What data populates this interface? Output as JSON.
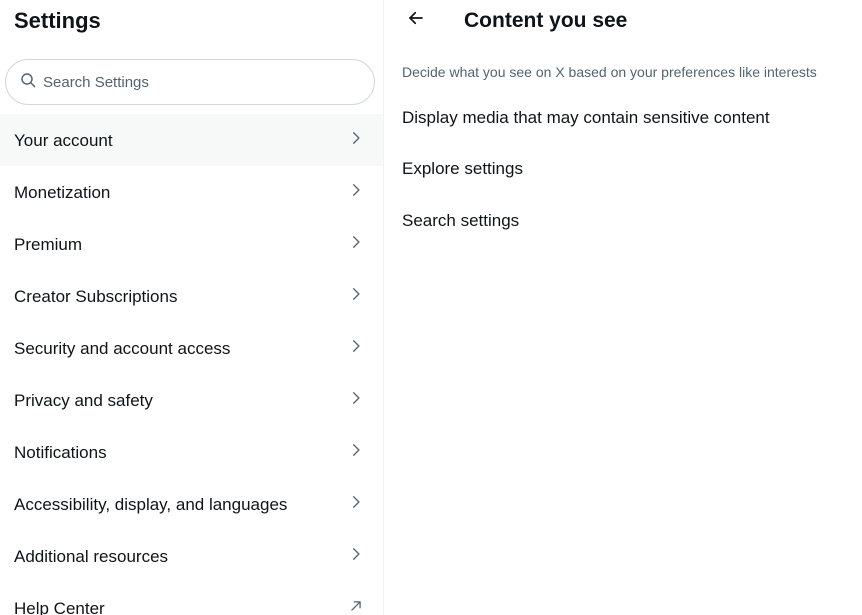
{
  "left": {
    "title": "Settings",
    "search": {
      "placeholder": "Search Settings",
      "value": ""
    },
    "items": [
      {
        "label": "Your account",
        "icon": "chevron-right-icon",
        "active": true
      },
      {
        "label": "Monetization",
        "icon": "chevron-right-icon"
      },
      {
        "label": "Premium",
        "icon": "chevron-right-icon"
      },
      {
        "label": "Creator Subscriptions",
        "icon": "chevron-right-icon"
      },
      {
        "label": "Security and account access",
        "icon": "chevron-right-icon"
      },
      {
        "label": "Privacy and safety",
        "icon": "chevron-right-icon"
      },
      {
        "label": "Notifications",
        "icon": "chevron-right-icon"
      },
      {
        "label": "Accessibility, display, and languages",
        "icon": "chevron-right-icon"
      },
      {
        "label": "Additional resources",
        "icon": "chevron-right-icon"
      },
      {
        "label": "Help Center",
        "icon": "external-link-arrow-icon"
      }
    ]
  },
  "right": {
    "title": "Content you see",
    "subtitle": "Decide what you see on X based on your preferences like interests",
    "items": [
      {
        "label": "Display media that may contain sensitive content"
      },
      {
        "label": "Explore settings"
      },
      {
        "label": "Search settings"
      }
    ]
  },
  "colors": {
    "text_primary": "#0f1419",
    "text_secondary": "#536471",
    "active_row_bg": "#f7f9f9",
    "border": "#cfd9de"
  }
}
